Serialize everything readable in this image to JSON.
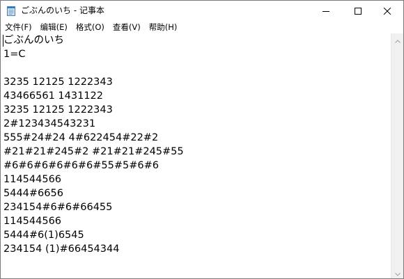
{
  "window": {
    "title": "ごぶんのいち - 记事本",
    "icon": "notepad-icon",
    "controls": {
      "minimize_icon": "minimize-icon",
      "maximize_icon": "maximize-icon",
      "close_icon": "close-icon"
    }
  },
  "menu": {
    "items": [
      {
        "label": "文件(F)"
      },
      {
        "label": "编辑(E)"
      },
      {
        "label": "格式(O)"
      },
      {
        "label": "查看(V)"
      },
      {
        "label": "帮助(H)"
      }
    ]
  },
  "editor": {
    "lines": [
      "ごぶんのいち",
      "1=C",
      "",
      "3235 12125 1222343",
      "43466561 1431122",
      "3235 12125 1222343",
      "2#123434543231",
      "555#24#24 4#622454#22#2",
      "#21#21#245#2 #21#21#245#55",
      "#6#6#6#6#6#6#55#5#6#6",
      "114544566",
      "5444#6656",
      "234154#6#6#66455",
      "114544566",
      "5444#6(1)6545",
      "234154 (1)#66454344"
    ]
  },
  "colors": {
    "window_border": "#7a7a7a",
    "background": "#ffffff",
    "text": "#000000",
    "scrollbar": "#f0f0f0"
  }
}
